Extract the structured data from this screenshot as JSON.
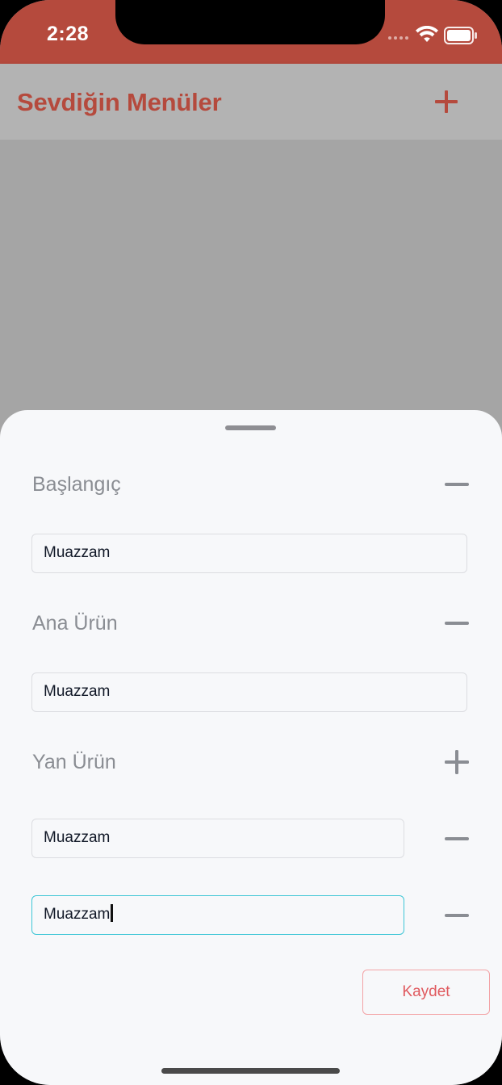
{
  "status_bar": {
    "time": "2:28",
    "color": "#b54a3d"
  },
  "nav": {
    "title": "Sevdiğin Menüler",
    "add_icon": "plus-icon"
  },
  "sheet": {
    "sections": [
      {
        "label": "Başlangıç",
        "action_icon": "minus-icon"
      },
      {
        "label": "Ana Ürün",
        "action_icon": "minus-icon"
      },
      {
        "label": "Yan Ürün",
        "action_icon": "plus-icon"
      }
    ],
    "fields": {
      "starter": "Muazzam",
      "main": "Muazzam",
      "side_1": "Muazzam",
      "side_2": "Muazzam"
    },
    "save_label": "Kaydet"
  },
  "colors": {
    "accent": "#b54a3d",
    "save_text": "#e05a5f",
    "focus_border": "#3ec6d6"
  }
}
